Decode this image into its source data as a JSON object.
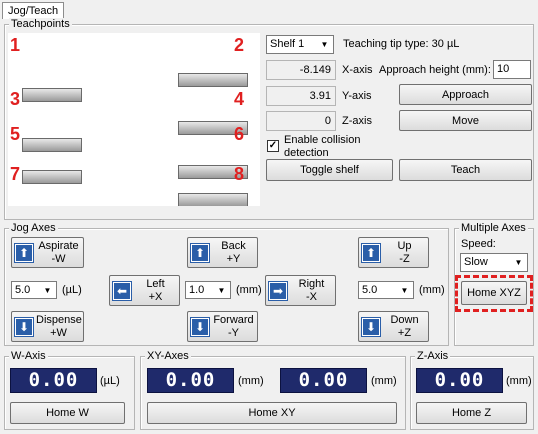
{
  "tab": {
    "label": "Jog/Teach"
  },
  "teachpoints": {
    "legend": "Teachpoints",
    "numbers": [
      "1",
      "2",
      "3",
      "4",
      "5",
      "6",
      "7",
      "8"
    ],
    "shelf_select": "Shelf 1",
    "tip_type": "Teaching tip type: 30 µL",
    "x_value": "-8.149",
    "x_label": "X-axis",
    "y_value": "3.91",
    "y_label": "Y-axis",
    "z_value": "0",
    "z_label": "Z-axis",
    "approach_height_label": "Approach height (mm):",
    "approach_height_value": "10",
    "approach_button": "Approach",
    "move_button": "Move",
    "collision_label": "Enable collision detection",
    "collision_checked": true,
    "toggle_shelf_button": "Toggle shelf",
    "teach_button": "Teach"
  },
  "jog": {
    "legend": "Jog Axes",
    "aspirate": "Aspirate\n-W",
    "dispense": "Dispense\n+W",
    "back": "Back\n+Y",
    "forward": "Forward\n-Y",
    "left": "Left\n+X",
    "right": "Right\n-X",
    "up": "Up\n-Z",
    "down": "Down\n+Z",
    "w_step": "5.0",
    "w_unit": "(µL)",
    "xy_step": "1.0",
    "xy_unit": "(mm)",
    "z_step": "5.0",
    "z_unit": "(mm)"
  },
  "multi": {
    "legend": "Multiple Axes",
    "speed_label": "Speed:",
    "speed_value": "Slow",
    "home_xyz": "Home XYZ",
    "highlight_color": "#e02020"
  },
  "w_axis": {
    "legend": "W-Axis",
    "value": "0.00",
    "unit": "(µL)",
    "home": "Home W"
  },
  "xy_axes": {
    "legend": "XY-Axes",
    "x_value": "0.00",
    "x_unit": "(mm)",
    "y_value": "0.00",
    "y_unit": "(mm)",
    "home": "Home XY"
  },
  "z_axis": {
    "legend": "Z-Axis",
    "value": "0.00",
    "unit": "(mm)",
    "home": "Home Z"
  }
}
